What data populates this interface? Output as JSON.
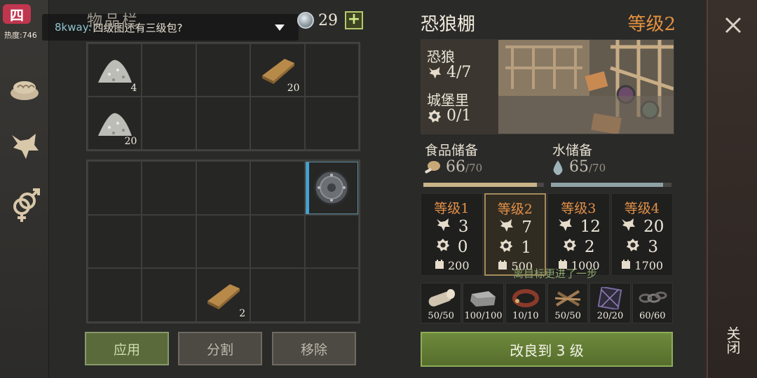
{
  "heat": {
    "icon_char": "四",
    "label": "热度:746"
  },
  "chat": {
    "user": "8kway:",
    "message": "四级图还有三级包?"
  },
  "inventory": {
    "title": "物品栏",
    "currency_value": "29",
    "slots_top": [
      {
        "icon": "sand-pile-icon",
        "count": "4"
      },
      {
        "icon": "",
        "count": ""
      },
      {
        "icon": "",
        "count": ""
      },
      {
        "icon": "copper-ingot-icon",
        "count": "20"
      },
      {
        "icon": "",
        "count": ""
      },
      {
        "icon": "sand-pile-icon",
        "count": "20"
      },
      {
        "icon": "",
        "count": ""
      },
      {
        "icon": "",
        "count": ""
      },
      {
        "icon": "",
        "count": ""
      },
      {
        "icon": "",
        "count": ""
      }
    ],
    "slots_bottom": [
      {
        "icon": "",
        "count": ""
      },
      {
        "icon": "",
        "count": ""
      },
      {
        "icon": "",
        "count": ""
      },
      {
        "icon": "",
        "count": ""
      },
      {
        "icon": "round-shield-icon",
        "count": ""
      },
      {
        "icon": "",
        "count": ""
      },
      {
        "icon": "",
        "count": ""
      },
      {
        "icon": "",
        "count": ""
      },
      {
        "icon": "",
        "count": ""
      },
      {
        "icon": "",
        "count": ""
      },
      {
        "icon": "",
        "count": ""
      },
      {
        "icon": "",
        "count": ""
      },
      {
        "icon": "copper-ingot-icon",
        "count": "2"
      },
      {
        "icon": "",
        "count": ""
      },
      {
        "icon": "",
        "count": ""
      }
    ],
    "buttons": {
      "apply": "应用",
      "split": "分割",
      "remove": "移除"
    }
  },
  "building": {
    "title": "恐狼棚",
    "level": "等级2",
    "wolves_label": "恐狼",
    "wolves_value": "4/7",
    "castle_label": "城堡里",
    "castle_value": "0/1",
    "food_label": "食品储备",
    "food_value": "66",
    "food_max": "/70",
    "water_label": "水储备",
    "water_value": "65",
    "water_max": "/70",
    "food_fraction": 0.943,
    "water_fraction": 0.929,
    "colors": {
      "food": "#c9b48a",
      "water": "#8fa2a6",
      "accent": "#e4923e"
    }
  },
  "levels": [
    {
      "title": "等级1",
      "wolves": "3",
      "castle": "0",
      "cost": "200",
      "current": false
    },
    {
      "title": "等级2",
      "wolves": "7",
      "castle": "1",
      "cost": "500",
      "current": true
    },
    {
      "title": "等级3",
      "wolves": "12",
      "castle": "2",
      "cost": "1000",
      "current": false
    },
    {
      "title": "等级4",
      "wolves": "20",
      "castle": "3",
      "cost": "1700",
      "current": false
    }
  ],
  "progress_message": "离目标更进了一步",
  "materials": [
    {
      "icon": "wood-log-icon",
      "count": "50/50"
    },
    {
      "icon": "stone-block-icon",
      "count": "100/100"
    },
    {
      "icon": "leather-collar-icon",
      "count": "10/10"
    },
    {
      "icon": "sticks-icon",
      "count": "50/50"
    },
    {
      "icon": "net-icon",
      "count": "20/20"
    },
    {
      "icon": "chain-icon",
      "count": "60/60"
    }
  ],
  "upgrade_button": "改良到 3 级",
  "close_label": "关闭"
}
